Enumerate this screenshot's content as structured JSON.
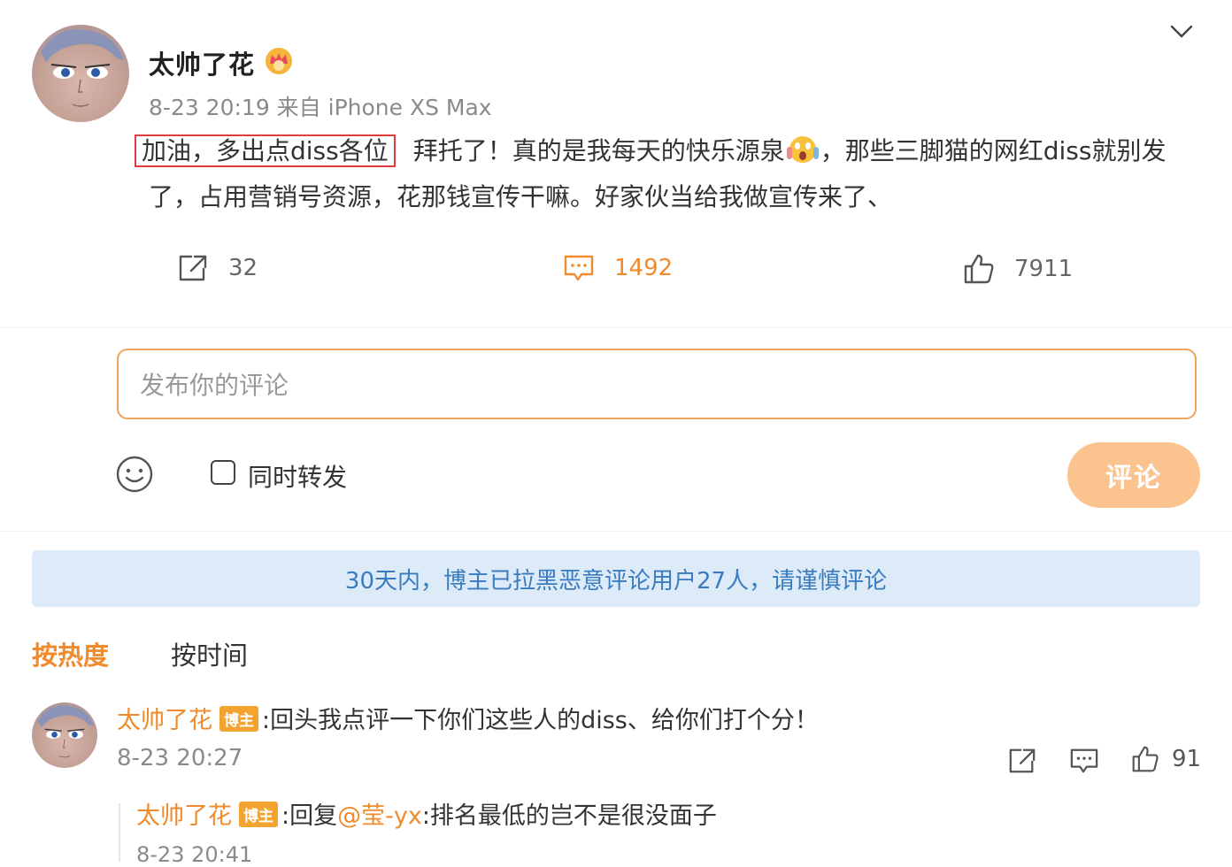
{
  "post": {
    "author": "太帅了花",
    "meta": "8-23 20:19  来自 iPhone XS Max",
    "highlighted_text": "加油，多出点diss各位",
    "text_part1": "拜托了！真的是我每天的快乐源泉",
    "text_part2": "，那些三脚猫的网红diss就别发了，占用营销号资源，花那钱宣传干嘛。好家伙当给我做宣传来了、",
    "shares": "32",
    "comments": "1492",
    "likes": "7911"
  },
  "composer": {
    "placeholder": "发布你的评论",
    "repost_label": "同时转发",
    "submit_label": "评论"
  },
  "notice": "30天内，博主已拉黑恶意评论用户27人，请谨慎评论",
  "sort": {
    "hot": "按热度",
    "time": "按时间"
  },
  "comments": [
    {
      "author": "太帅了花",
      "badge": "博主",
      "text": ":回头我点评一下你们这些人的diss、给你们打个分！",
      "time": "8-23 20:27",
      "likes": "91",
      "reply": {
        "author": "太帅了花",
        "badge": "博主",
        "prefix": ":回复",
        "mention": "@莹-yx",
        "text": ":排名最低的岂不是很没面子",
        "time": "8-23 20:41"
      }
    }
  ],
  "colors": {
    "accent": "#f08a2c",
    "notice_bg": "#dcebf7",
    "notice_text": "#3a7bc0",
    "submit_bg": "#fbc48f",
    "highlight_border": "#e03c3c"
  }
}
